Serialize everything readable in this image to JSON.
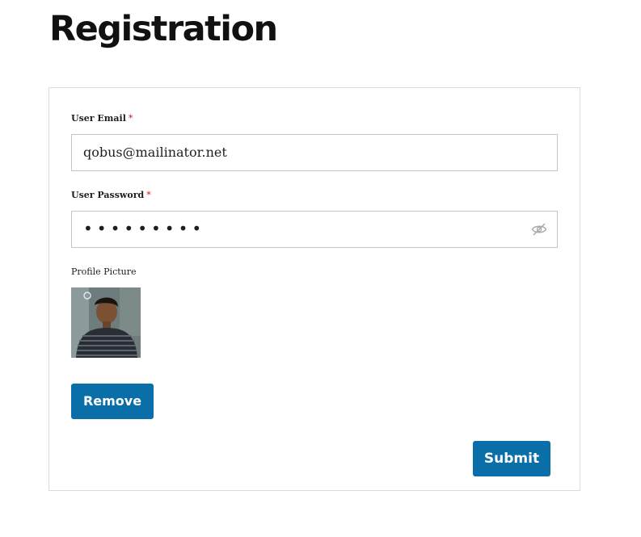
{
  "page": {
    "title": "Registration"
  },
  "form": {
    "email": {
      "label": "User Email",
      "required_mark": "*",
      "value": "qobus@mailinator.net"
    },
    "password": {
      "label": "User Password",
      "required_mark": "*",
      "masked_value": "•••••••••",
      "toggle_icon": "eye-slash-icon"
    },
    "profile_picture": {
      "label": "Profile Picture"
    },
    "buttons": {
      "remove_label": "Remove",
      "submit_label": "Submit"
    }
  },
  "colors": {
    "button_bg": "#0a6fa8",
    "required": "#cc1818",
    "border": "#c3c4c7",
    "card_border": "#dcdcde"
  }
}
